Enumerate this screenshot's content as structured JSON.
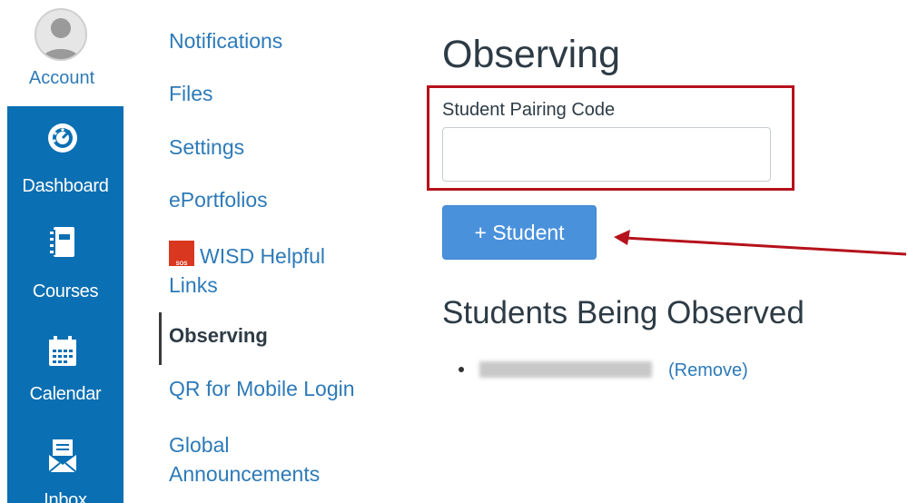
{
  "global_nav": {
    "account_label": "Account",
    "items": [
      {
        "label": "Dashboard",
        "icon": "dashboard-icon"
      },
      {
        "label": "Courses",
        "icon": "courses-icon"
      },
      {
        "label": "Calendar",
        "icon": "calendar-icon"
      },
      {
        "label": "Inbox",
        "icon": "inbox-icon"
      }
    ],
    "brand_color": "#0a6fb3"
  },
  "sub_nav": {
    "items": [
      {
        "label": "Notifications"
      },
      {
        "label": "Files"
      },
      {
        "label": "Settings"
      },
      {
        "label": "ePortfolios"
      },
      {
        "label": "WISD Helpful Links",
        "icon": "sos-icon"
      },
      {
        "label": "Observing",
        "active": true
      },
      {
        "label": "QR for Mobile Login"
      },
      {
        "label": "Global Announcements"
      }
    ],
    "sos_icon_text": "SOS"
  },
  "main": {
    "title": "Observing",
    "pairing": {
      "label": "Student Pairing Code",
      "value": "",
      "placeholder": ""
    },
    "add_button_label": "+ Student",
    "observed_title": "Students Being Observed",
    "students": [
      {
        "name": "(blurred)",
        "remove_label": "(Remove)"
      }
    ],
    "highlight_color": "#b5121b",
    "accent_color": "#4a91dc"
  }
}
